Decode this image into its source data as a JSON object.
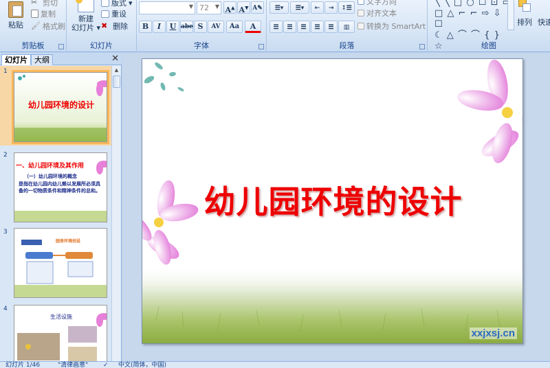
{
  "ribbon": {
    "clipboard": {
      "label": "剪贴板",
      "paste": "粘贴",
      "cut": "剪切",
      "copy": "复制",
      "format_painter": "格式刷"
    },
    "slides": {
      "label": "幻灯片",
      "new_slide": "新建\n幻灯片",
      "layout": "版式",
      "reset": "重设",
      "delete": "删除"
    },
    "font": {
      "label": "字体",
      "font_name": "",
      "font_size": "72",
      "bold": "B",
      "italic": "I",
      "underline": "U",
      "strike": "abe",
      "shadow": "S",
      "spacing": "AV",
      "case": "Aa",
      "color": "A"
    },
    "paragraph": {
      "label": "段落",
      "text_direction": "文字方向",
      "align_text": "对齐文本",
      "smartart": "转换为 SmartArt"
    },
    "drawing": {
      "label": "绘图",
      "arrange": "排列",
      "quick_styles": "快速"
    }
  },
  "panel": {
    "tab_slides": "幻灯片",
    "tab_outline": "大纲",
    "close": "✕",
    "thumbnails": [
      {
        "num": "1",
        "title": "幼儿园环境的设计",
        "selected": true
      },
      {
        "num": "2",
        "title": "一、幼儿园环境及其作用",
        "subtitle": "（一）幼儿园环境的概念",
        "body": "是指在幼儿园内幼儿赖以发展所必须具备的一切物质条件和精神条件的总和。",
        "selected": false
      },
      {
        "num": "3",
        "title": "园舍环境创设",
        "selected": false
      },
      {
        "num": "4",
        "title": "生活设施",
        "selected": false
      }
    ]
  },
  "slide": {
    "title": "幼儿园环境的设计",
    "watermark": "xxjxsj.cn"
  },
  "status": {
    "slide_info": "幻灯片 1/46",
    "theme": "\"清律画意\"",
    "language": "中文(简体，中国)"
  },
  "colors": {
    "title_red": "#ee0000",
    "ribbon_blue": "#15428b",
    "selected_orange": "#f9b75b"
  }
}
